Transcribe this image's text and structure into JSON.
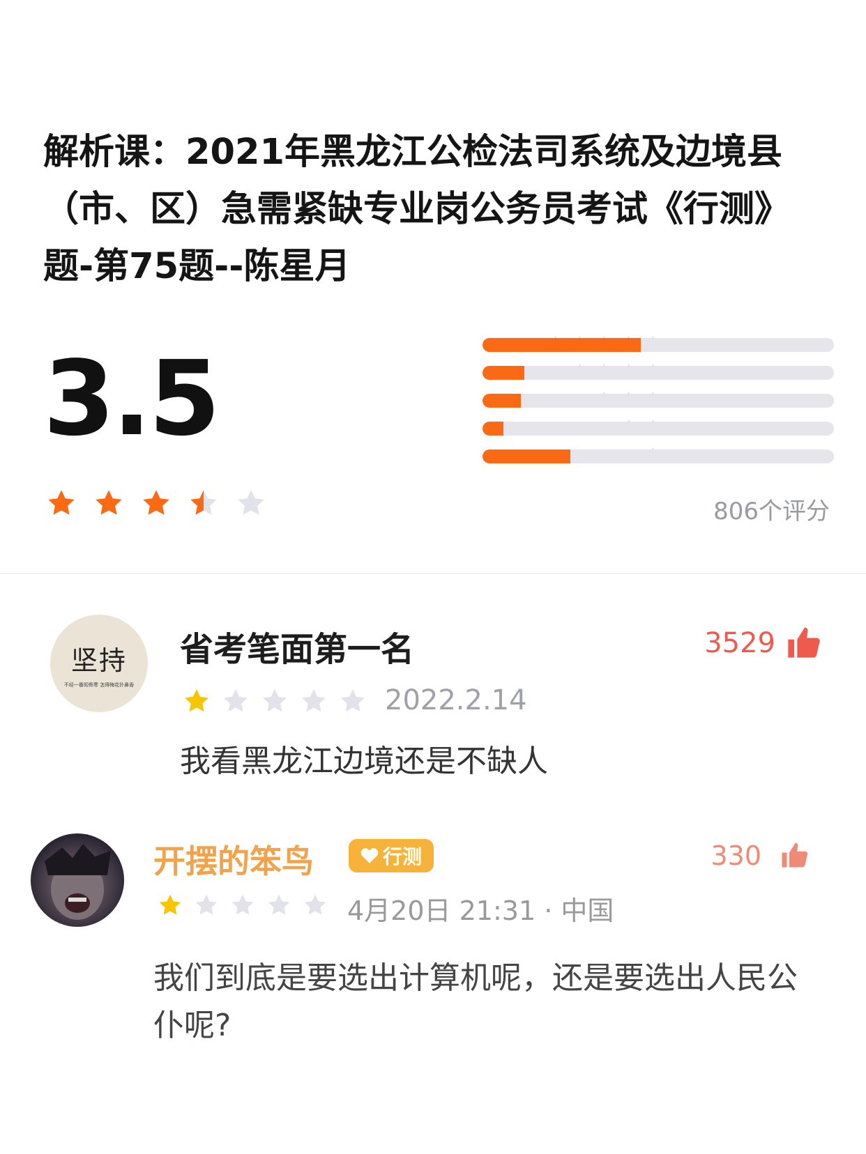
{
  "course": {
    "title": "解析课：2021年黑龙江公检法司系统及边境县（市、区）急需紧缺专业岗公务员考试《行测》题-第75题--陈星月"
  },
  "rating": {
    "score": "3.5",
    "score_value": 3.5,
    "count_label": "806个评分",
    "distribution": [
      {
        "stars": 5,
        "fraction": 0.45
      },
      {
        "stars": 4,
        "fraction": 0.12
      },
      {
        "stars": 3,
        "fraction": 0.11
      },
      {
        "stars": 2,
        "fraction": 0.06
      },
      {
        "stars": 1,
        "fraction": 0.25
      }
    ],
    "colors": {
      "accent": "#fa6a14",
      "track": "#e6e5ec",
      "empty_star": "#e2e2ea",
      "dist_star": "#dadae2"
    }
  },
  "reviews": [
    {
      "username": "省考笔面第一名",
      "avatar_text": "坚持",
      "avatar_subtext": "不经一番彻骨寒 怎得梅花扑鼻香",
      "likes": "3529",
      "stars": 1,
      "date": "2022.2.14",
      "text": "我看黑龙江边境还是不缺人",
      "colors": {
        "star": "#f7c600",
        "likes": "#ef5a4e"
      }
    },
    {
      "username": "开摆的笨鸟",
      "badge": "行测",
      "likes": "330",
      "stars": 1,
      "date": "4月20日  21:31 · 中国",
      "text": "我们到底是要选出计算机呢，还是要选出人民公仆呢?",
      "colors": {
        "username": "#f1a24a",
        "badge": "#f7b23a",
        "star": "#f7c600",
        "likes": "#ef8a76"
      }
    }
  ]
}
